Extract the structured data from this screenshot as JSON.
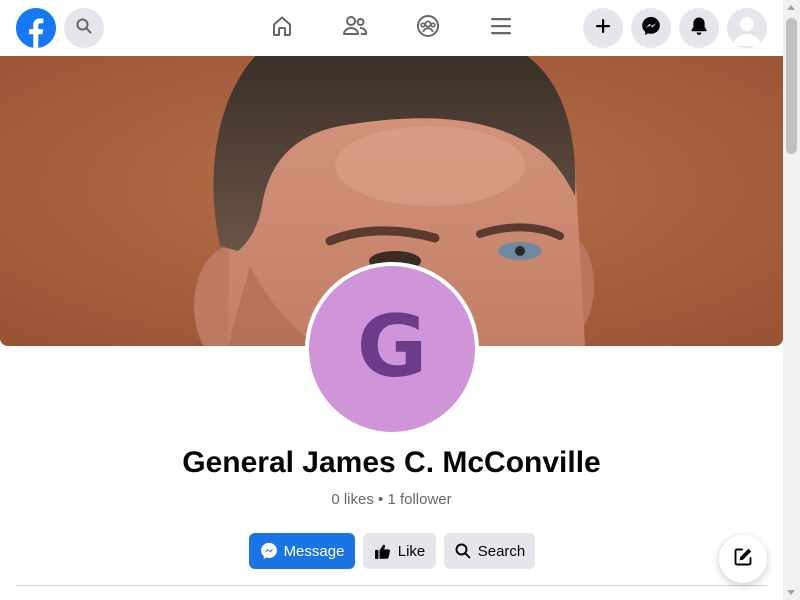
{
  "header": {
    "logo_icon": "facebook-logo-icon",
    "search_icon": "search-icon",
    "nav_icons": [
      "home-icon",
      "friends-icon",
      "groups-icon",
      "menu-icon"
    ],
    "actions": [
      "create-plus-icon",
      "messenger-icon",
      "notifications-bell-icon",
      "profile-avatar-icon"
    ]
  },
  "page": {
    "name": "General James C. McConville",
    "stats": "0 likes • 1 follower",
    "avatar_letter": "G",
    "avatar_bg_color": "#d094d8",
    "avatar_letter_color": "#6c3c8c"
  },
  "actions": {
    "message_label": "Message",
    "like_label": "Like",
    "search_label": "Search"
  },
  "colors": {
    "brand_blue": "#1877f2",
    "button_gray": "#e4e6eb",
    "secondary_text": "#65676b"
  }
}
